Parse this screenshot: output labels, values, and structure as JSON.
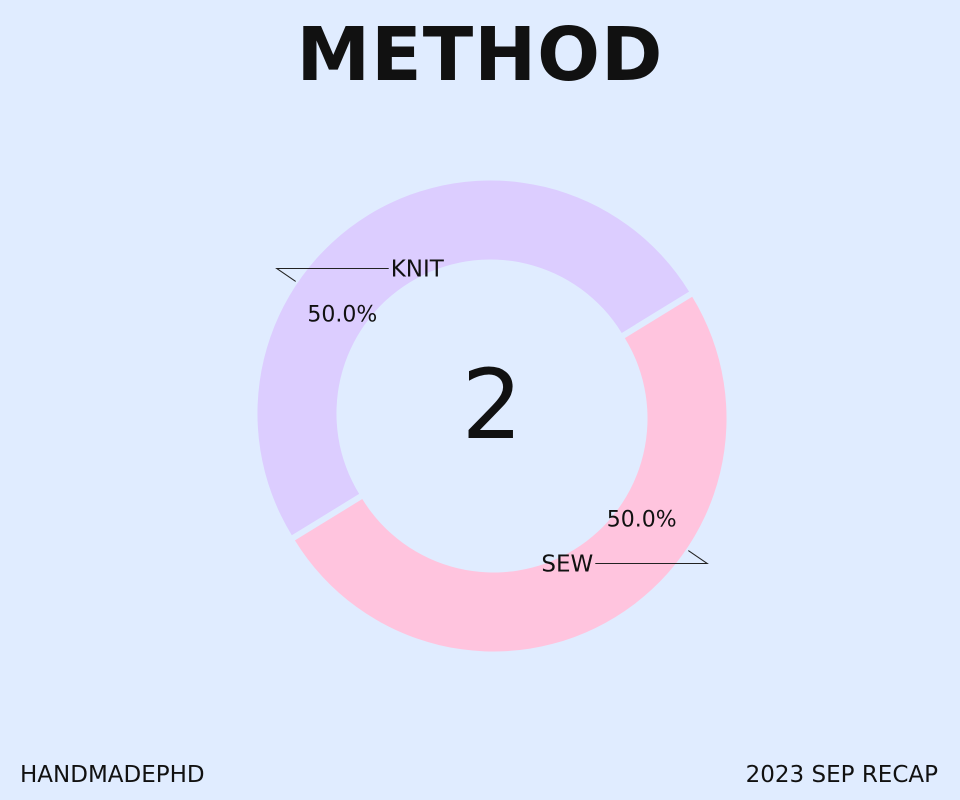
{
  "title": "METHOD",
  "center_value": "2",
  "footer": {
    "left": "HANDMADEPHD",
    "right": "2023 SEP RECAP"
  },
  "colors": {
    "background": "#e0ecff",
    "KNIT": "#dccdff",
    "SEW": "#ffc4de"
  },
  "chart_data": {
    "type": "pie",
    "title": "METHOD",
    "categories": [
      "KNIT",
      "SEW"
    ],
    "values": [
      1,
      1
    ],
    "percent_labels": [
      "50.0%",
      "50.0%"
    ],
    "donut": true,
    "center_label": "2",
    "legend": "none"
  }
}
